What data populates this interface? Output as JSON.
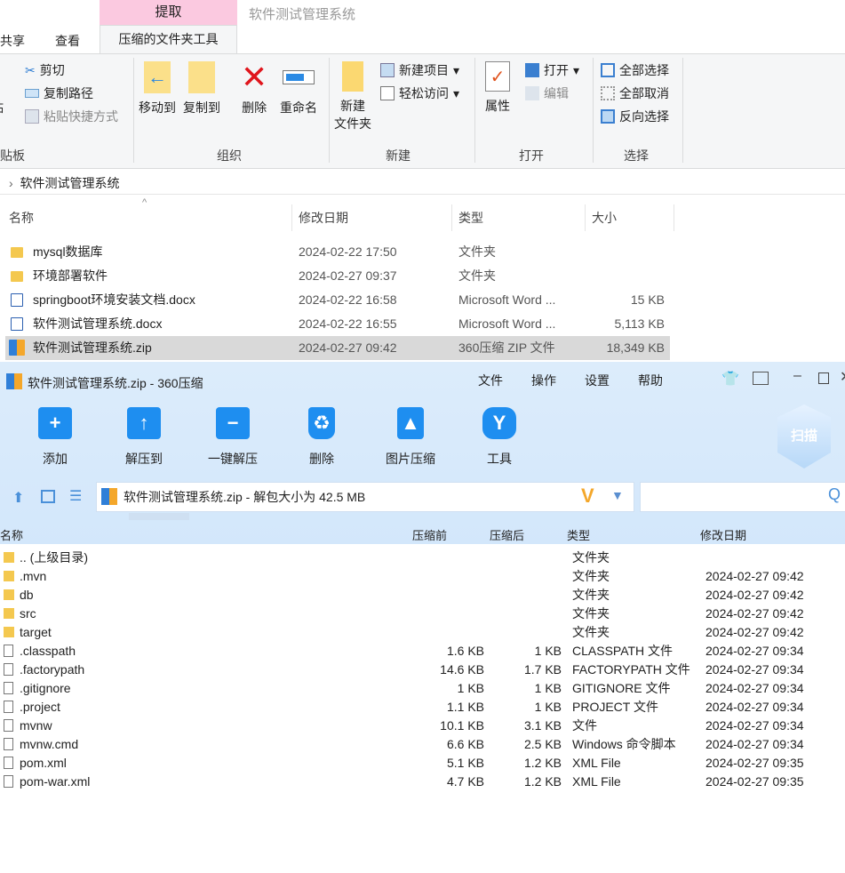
{
  "explorer": {
    "context_tab": "提取",
    "window_title": "软件测试管理系统",
    "tabs": [
      "共享",
      "查看",
      "压缩的文件夹工具"
    ],
    "clipboard": {
      "paste": "贴",
      "cut": "剪切",
      "copy_path": "复制路径",
      "paste_shortcut": "粘贴快捷方式",
      "group": "贴板"
    },
    "organize": {
      "move_to": "移动到",
      "copy_to": "复制到",
      "delete": "删除",
      "rename": "重命名",
      "group": "组织"
    },
    "new": {
      "new_folder_1": "新建",
      "new_folder_2": "文件夹",
      "new_item": "新建项目",
      "easy_access": "轻松访问",
      "group": "新建"
    },
    "open": {
      "properties": "属性",
      "open": "打开",
      "edit": "编辑",
      "group": "打开"
    },
    "select": {
      "all": "全部选择",
      "none": "全部取消",
      "invert": "反向选择",
      "group": "选择"
    },
    "breadcrumb": "软件测试管理系统",
    "columns": [
      "名称",
      "修改日期",
      "类型",
      "大小"
    ],
    "files": [
      {
        "name": "mysql数据库",
        "date": "2024-02-22 17:50",
        "type": "文件夹",
        "size": "",
        "icon": "folder"
      },
      {
        "name": "环境部署软件",
        "date": "2024-02-27 09:37",
        "type": "文件夹",
        "size": "",
        "icon": "folder"
      },
      {
        "name": "springboot环境安装文档.docx",
        "date": "2024-02-22 16:58",
        "type": "Microsoft Word ...",
        "size": "15 KB",
        "icon": "word"
      },
      {
        "name": "软件测试管理系统.docx",
        "date": "2024-02-22 16:55",
        "type": "Microsoft Word ...",
        "size": "5,113 KB",
        "icon": "word"
      },
      {
        "name": "软件测试管理系统.zip",
        "date": "2024-02-27 09:42",
        "type": "360压缩 ZIP 文件",
        "size": "18,349 KB",
        "icon": "zip",
        "selected": true
      }
    ]
  },
  "zip": {
    "title": "软件测试管理系统.zip - 360压缩",
    "menu": [
      "文件",
      "操作",
      "设置",
      "帮助"
    ],
    "toolbar": [
      "添加",
      "解压到",
      "一键解压",
      "删除",
      "图片压缩",
      "工具"
    ],
    "scan": "扫描",
    "address": "软件测试管理系统.zip - 解包大小为 42.5 MB",
    "columns": [
      "名称",
      "压缩前",
      "压缩后",
      "类型",
      "修改日期"
    ],
    "rows": [
      {
        "name": ".. (上级目录)",
        "before": "",
        "after": "",
        "type": "文件夹",
        "date": "",
        "icon": "folder"
      },
      {
        "name": ".mvn",
        "before": "",
        "after": "",
        "type": "文件夹",
        "date": "2024-02-27 09:42",
        "icon": "folder"
      },
      {
        "name": "db",
        "before": "",
        "after": "",
        "type": "文件夹",
        "date": "2024-02-27 09:42",
        "icon": "folder"
      },
      {
        "name": "src",
        "before": "",
        "after": "",
        "type": "文件夹",
        "date": "2024-02-27 09:42",
        "icon": "folder"
      },
      {
        "name": "target",
        "before": "",
        "after": "",
        "type": "文件夹",
        "date": "2024-02-27 09:42",
        "icon": "folder"
      },
      {
        "name": ".classpath",
        "before": "1.6 KB",
        "after": "1 KB",
        "type": "CLASSPATH 文件",
        "date": "2024-02-27 09:34",
        "icon": "file"
      },
      {
        "name": ".factorypath",
        "before": "14.6 KB",
        "after": "1.7 KB",
        "type": "FACTORYPATH 文件",
        "date": "2024-02-27 09:34",
        "icon": "file"
      },
      {
        "name": ".gitignore",
        "before": "1 KB",
        "after": "1 KB",
        "type": "GITIGNORE 文件",
        "date": "2024-02-27 09:34",
        "icon": "file"
      },
      {
        "name": ".project",
        "before": "1.1 KB",
        "after": "1 KB",
        "type": "PROJECT 文件",
        "date": "2024-02-27 09:34",
        "icon": "file"
      },
      {
        "name": "mvnw",
        "before": "10.1 KB",
        "after": "3.1 KB",
        "type": "文件",
        "date": "2024-02-27 09:34",
        "icon": "file"
      },
      {
        "name": "mvnw.cmd",
        "before": "6.6 KB",
        "after": "2.5 KB",
        "type": "Windows 命令脚本",
        "date": "2024-02-27 09:34",
        "icon": "file"
      },
      {
        "name": "pom.xml",
        "before": "5.1 KB",
        "after": "1.2 KB",
        "type": "XML File",
        "date": "2024-02-27 09:35",
        "icon": "file"
      },
      {
        "name": "pom-war.xml",
        "before": "4.7 KB",
        "after": "1.2 KB",
        "type": "XML File",
        "date": "2024-02-27 09:35",
        "icon": "file"
      }
    ]
  }
}
